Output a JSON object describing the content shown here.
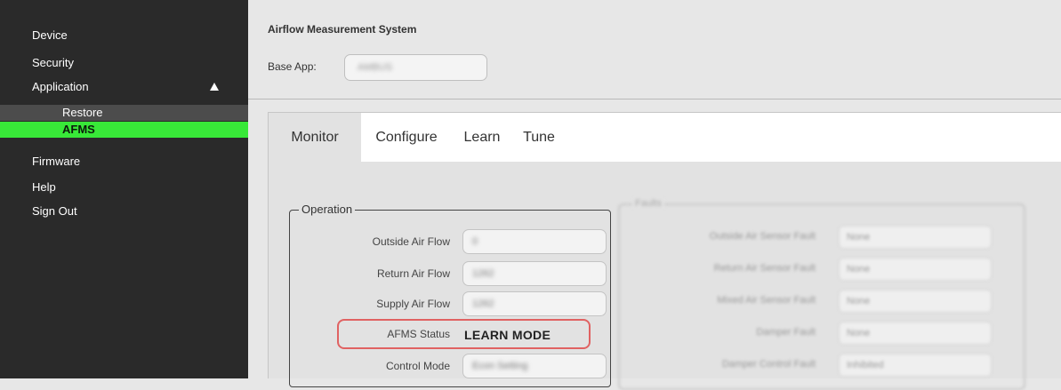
{
  "sidebar": {
    "items": [
      {
        "label": "Device"
      },
      {
        "label": "Security"
      },
      {
        "label": "Application"
      },
      {
        "label": "Restore"
      },
      {
        "label": "AFMS"
      },
      {
        "label": "Firmware"
      },
      {
        "label": "Help"
      },
      {
        "label": "Sign Out"
      }
    ],
    "expanded_icon": "caret-up-icon",
    "active_color": "#38e838"
  },
  "main": {
    "title": "Airflow Measurement System",
    "base_app_label": "Base App:",
    "base_app_value": "AMBUS",
    "tabs": [
      {
        "label": "Monitor",
        "active": true
      },
      {
        "label": "Configure"
      },
      {
        "label": "Learn"
      },
      {
        "label": "Tune"
      }
    ],
    "operation": {
      "legend": "Operation",
      "rows": [
        {
          "label": "Outside Air Flow",
          "value": "0"
        },
        {
          "label": "Return Air Flow",
          "value": "1262"
        },
        {
          "label": "Supply Air Flow",
          "value": "1262"
        },
        {
          "label": "AFMS Status",
          "value": "LEARN MODE"
        },
        {
          "label": "Control Mode",
          "value": "Econ Setting"
        }
      ],
      "highlight_color": "#e06262"
    },
    "faults": {
      "legend": "Faults",
      "rows": [
        {
          "label": "Outside Air Sensor Fault",
          "value": "None"
        },
        {
          "label": "Return Air Sensor Fault",
          "value": "None"
        },
        {
          "label": "Mixed Air Sensor Fault",
          "value": "None"
        },
        {
          "label": "Damper Fault",
          "value": "None"
        },
        {
          "label": "Damper Control Fault",
          "value": "Inhibited"
        }
      ]
    }
  }
}
